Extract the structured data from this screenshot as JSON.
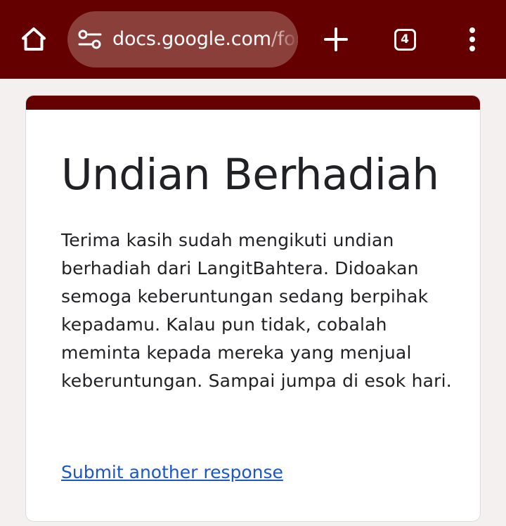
{
  "browser": {
    "url_host": "docs.google.com",
    "url_path": "/for",
    "tab_count": "4",
    "toolbar_color": "#640000",
    "icons": {
      "home": "home-icon",
      "site_info": "site-settings-icon",
      "new_tab": "plus-icon",
      "tabs": "tab-switcher-icon",
      "menu": "more-vert-icon"
    }
  },
  "form": {
    "accent_color": "#640000",
    "title": "Undian Berhadiah",
    "confirmation_message": "Terima kasih sudah mengikuti undian berhadiah dari LangitBahtera. Didoakan semoga keberuntungan sedang berpihak kepadamu. Kalau pun tidak, cobalah meminta kepada mereka yang menjual keberuntungan. Sampai jumpa di esok hari.",
    "submit_another_label": "Submit another response",
    "link_color": "#1a56c8"
  }
}
